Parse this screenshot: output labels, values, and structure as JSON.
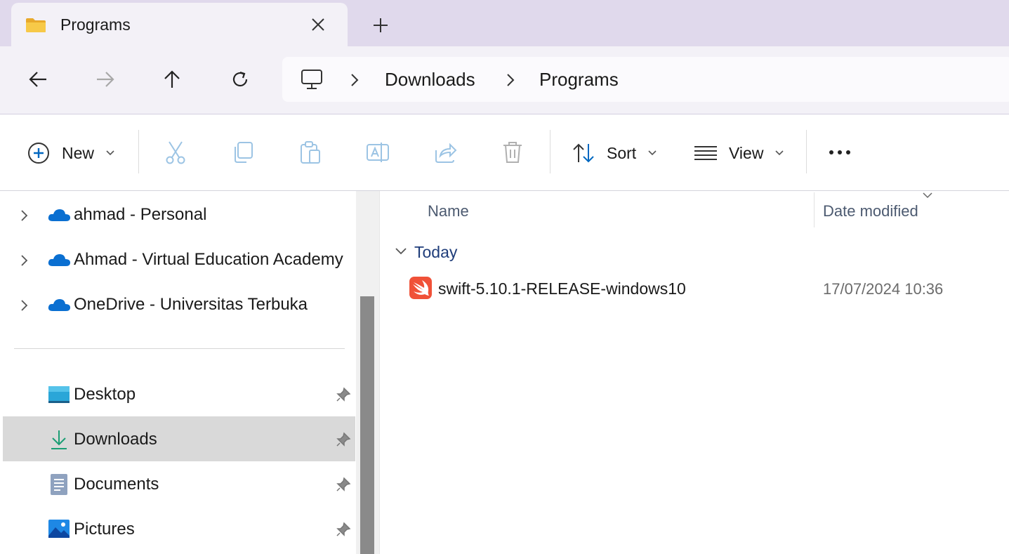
{
  "window": {
    "tab_title": "Programs",
    "tab_icon": "folder-icon"
  },
  "address": {
    "root_icon": "this-pc-icon",
    "segments": [
      "Downloads",
      "Programs"
    ]
  },
  "toolbar": {
    "new_label": "New",
    "sort_label": "Sort",
    "view_label": "View"
  },
  "sidebar": {
    "cloud_items": [
      {
        "label": "ahmad - Personal",
        "icon": "onedrive-icon"
      },
      {
        "label": "Ahmad - Virtual Education Academy",
        "icon": "onedrive-icon"
      },
      {
        "label": "OneDrive - Universitas Terbuka",
        "icon": "onedrive-icon"
      }
    ],
    "quick_access": [
      {
        "label": "Desktop",
        "icon": "desktop-icon",
        "pinned": true
      },
      {
        "label": "Downloads",
        "icon": "download-icon",
        "pinned": true,
        "selected": true
      },
      {
        "label": "Documents",
        "icon": "documents-icon",
        "pinned": true
      },
      {
        "label": "Pictures",
        "icon": "pictures-icon",
        "pinned": true
      }
    ]
  },
  "content": {
    "columns": [
      "Name",
      "Date modified"
    ],
    "groups": [
      {
        "label": "Today",
        "files": [
          {
            "name": "swift-5.10.1-RELEASE-windows10",
            "date_modified": "17/07/2024 10:36",
            "icon": "swift-icon"
          }
        ]
      }
    ]
  },
  "colors": {
    "accent": "#0067c0",
    "swift": "#f05138",
    "onedrive": "#0a6fd1",
    "selected_row": "#d9d9d9"
  }
}
